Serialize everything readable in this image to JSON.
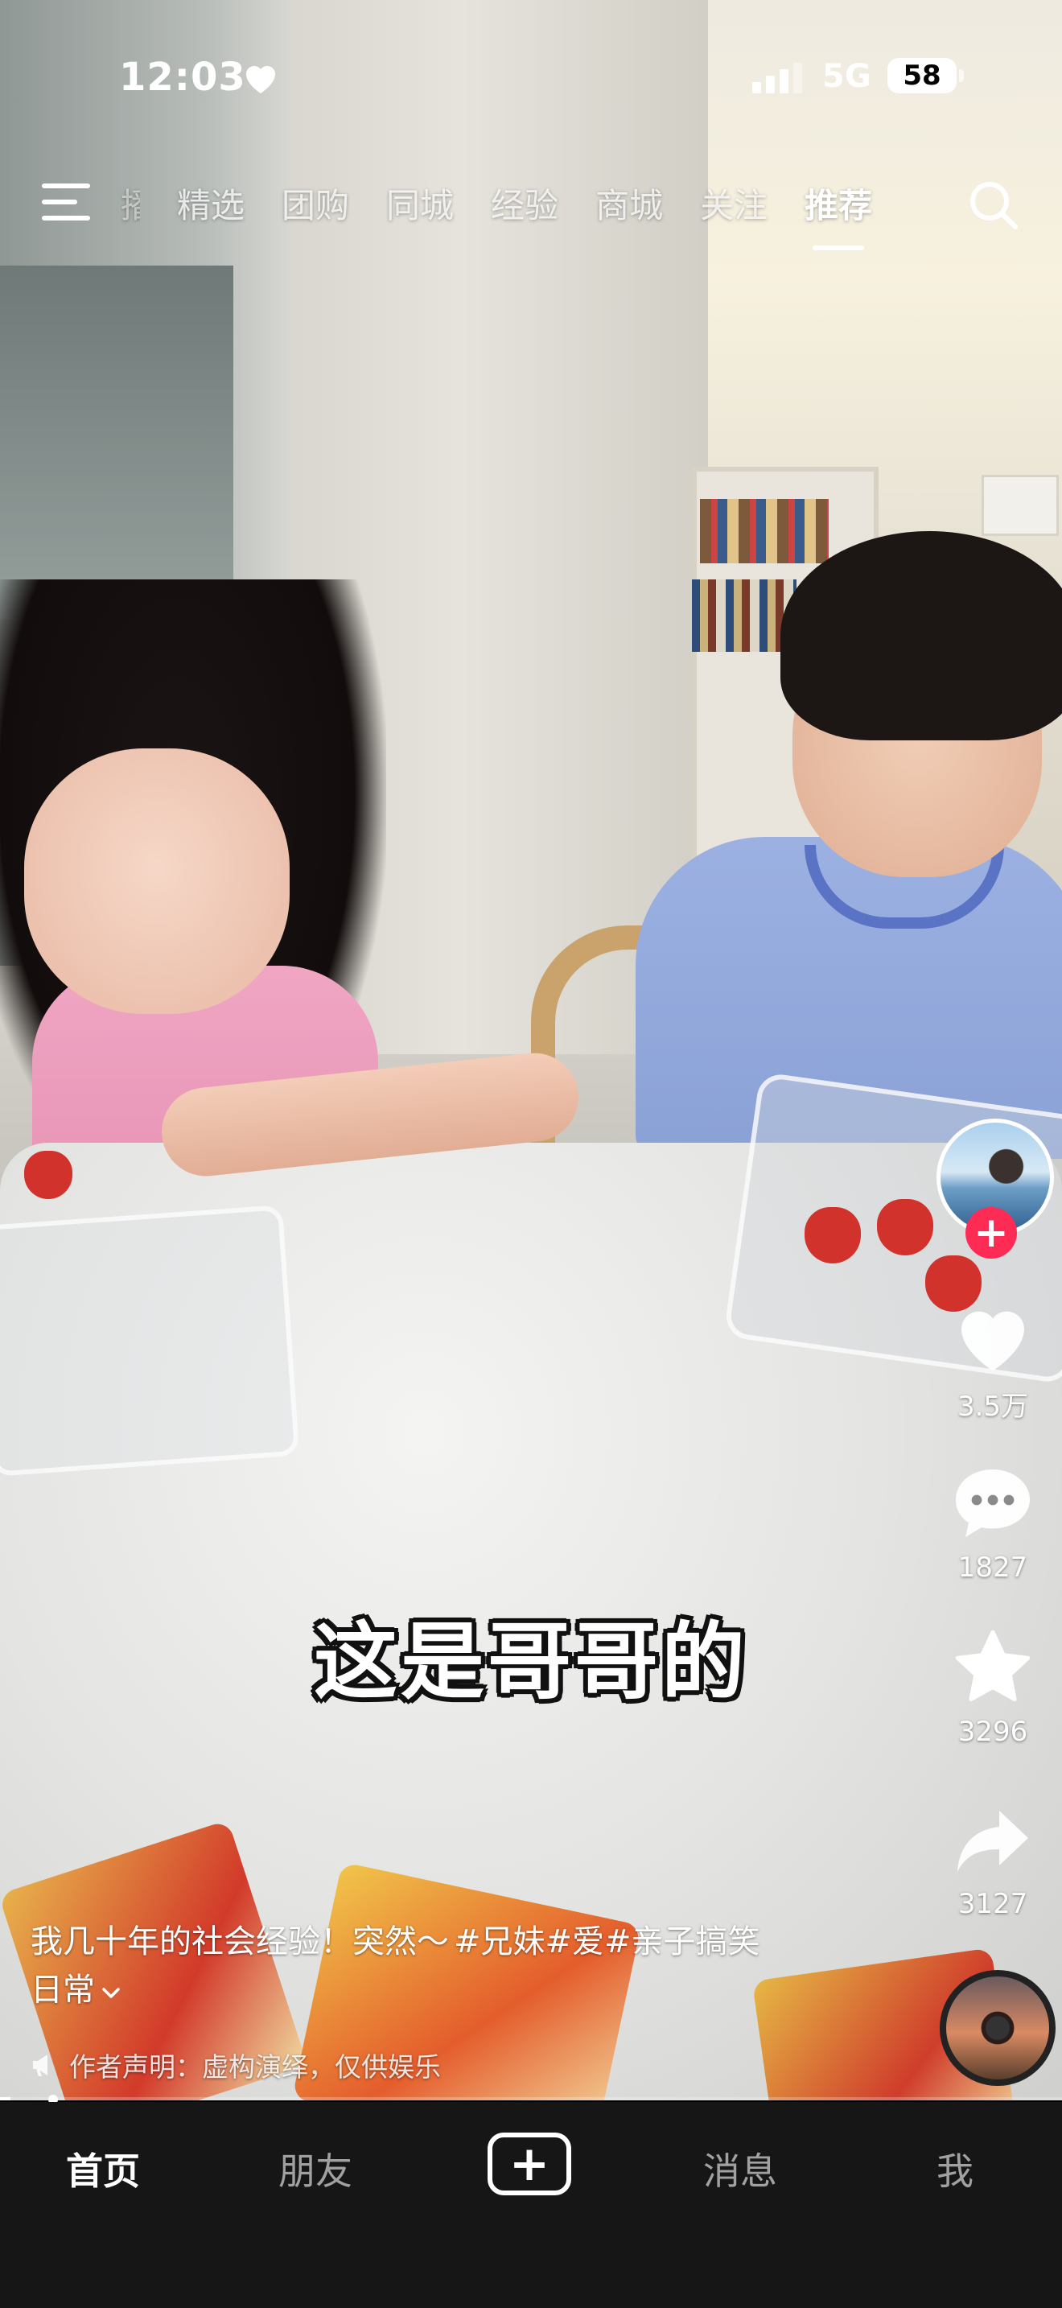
{
  "status_bar": {
    "time": "12:03",
    "network": "5G",
    "battery": "58",
    "heart_icon": "heart-icon"
  },
  "top_tabs": {
    "partial_tab": "播",
    "items": [
      "精选",
      "团购",
      "同城",
      "经验",
      "商城",
      "关注",
      "推荐"
    ],
    "active": "推荐",
    "menu_icon": "menu-icon",
    "search_icon": "search-icon"
  },
  "video": {
    "subtitle": "这是哥哥的"
  },
  "actions": {
    "likes": "3.5万",
    "comments": "1827",
    "favorites": "3296",
    "shares": "3127",
    "follow_icon": "plus-icon"
  },
  "description": {
    "text": "我几十年的社会经验！突然～",
    "tags": "#兄妹#爱#亲子搞笑",
    "text_line2": "日常",
    "expand_icon": "chevron-down-icon"
  },
  "disclaimer": {
    "text": "作者声明：虚构演绎，仅供娱乐",
    "icon": "megaphone-icon"
  },
  "playback_progress": 0.01,
  "bottom_nav": {
    "home": "首页",
    "friends": "朋友",
    "create": "+",
    "messages": "消息",
    "me": "我"
  },
  "colors": {
    "accent": "#fe2c55",
    "nav_background": "#161616"
  }
}
